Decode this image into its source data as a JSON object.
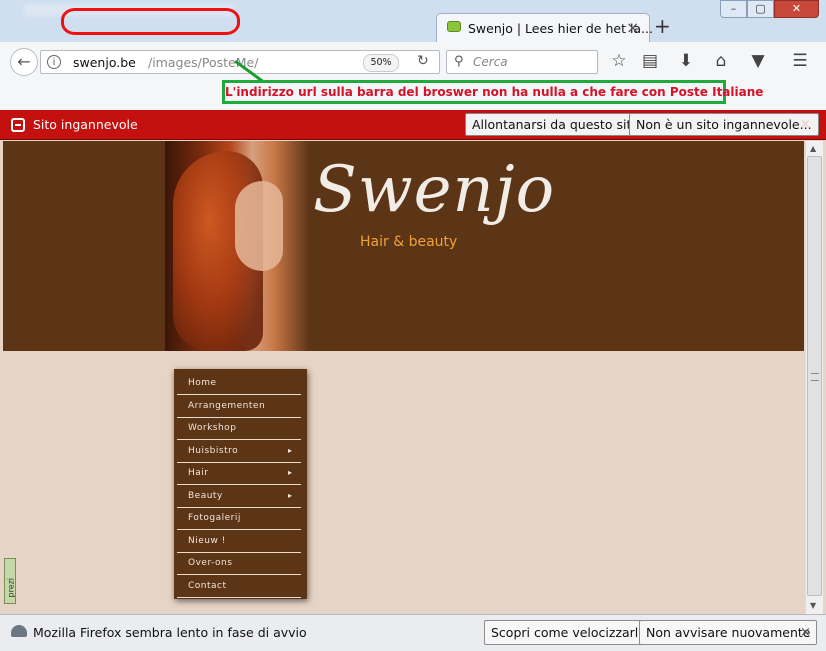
{
  "browser": {
    "tab_title": "Swenjo | Lees hier de het la...",
    "tab_close": "×",
    "new_tab": "+",
    "window_controls": {
      "minimize": "–",
      "maximize": "▢",
      "close": "✕"
    },
    "url_host": "swenjo.be",
    "url_path": "/images/PosteMe/",
    "zoom": "50%",
    "search_placeholder": "Cerca",
    "overflow_glyph": "»",
    "icons": [
      "back-arrow-icon",
      "info-icon",
      "reload-icon",
      "search-icon",
      "bookmark-star-icon",
      "reading-list-icon",
      "download-icon",
      "home-icon",
      "pocket-icon",
      "hamburger-menu-icon"
    ]
  },
  "annotation": {
    "text": "L'indirizzo url sulla barra del broswer non ha nulla a che fare con Poste Italiane",
    "border_color": "#1faa3c",
    "text_color": "#d4122a",
    "oval_color": "#e11111"
  },
  "warning_bar": {
    "label": "Sito ingannevole",
    "leave_button": "Allontanarsi da questo sito",
    "not_deceptive_button": "Non è un sito ingannevole...",
    "close": "×",
    "color": "#c4100f"
  },
  "page": {
    "brand": "Swenjo",
    "tagline": "Hair & beauty",
    "side_tab_label": "prezi",
    "menu": [
      {
        "label": "Home",
        "arrow": ""
      },
      {
        "label": "Arrangementen",
        "arrow": ""
      },
      {
        "label": "Workshop",
        "arrow": ""
      },
      {
        "label": "Huisbistro",
        "arrow": "▸"
      },
      {
        "label": "Hair",
        "arrow": "▸"
      },
      {
        "label": "Beauty",
        "arrow": "▸"
      },
      {
        "label": "Fotogalerij",
        "arrow": ""
      },
      {
        "label": "Nieuw !",
        "arrow": ""
      },
      {
        "label": "Over-ons",
        "arrow": ""
      },
      {
        "label": "Contact",
        "arrow": ""
      }
    ],
    "colors": {
      "header": "#5c3416",
      "body": "#e6d4c6",
      "tagline": "#f0a23a"
    }
  },
  "notification": {
    "text": "Mozilla Firefox sembra lento in fase di avvio",
    "speedup_button": "Scopri come velocizzarlo",
    "no_remind_button": "Non avvisare nuovamente",
    "close": "×"
  }
}
